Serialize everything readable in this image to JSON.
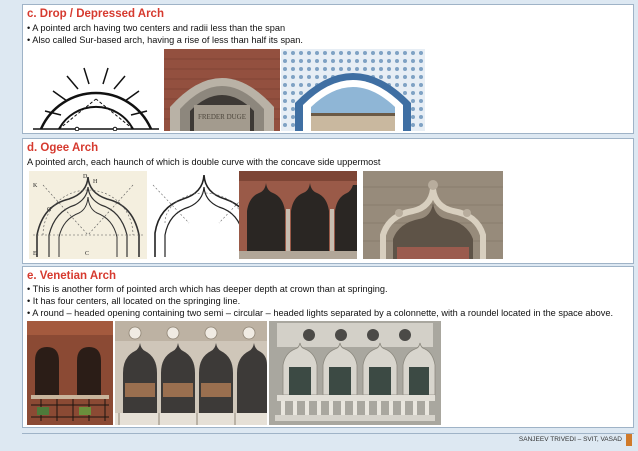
{
  "sections": {
    "drop": {
      "heading": "c. Drop / Depressed Arch",
      "bullets": [
        "• A pointed arch having two centers and radii less than the span",
        "• Also called Sur-based arch, having a rise of less than half its span."
      ],
      "inscription": "FREDER DUGE"
    },
    "ogee": {
      "heading": "d. Ogee Arch",
      "description": "A pointed arch, each haunch of which is double curve with the concave side uppermost",
      "diagram_labels": [
        "D",
        "H",
        "K",
        "G",
        "E",
        "C"
      ]
    },
    "venetian": {
      "heading": "e. Venetian Arch",
      "bullets": [
        "• This is another form of pointed arch which has deeper depth at crown than at springing.",
        "• It has four centers, all located on the springing line.",
        "• A round – headed opening containing two semi – circular – headed lights separated by a colonnette, with a roundel located in the space above."
      ]
    }
  },
  "footer": {
    "credit": "SANJEEV TRIVEDI – SVIT, VASAD"
  },
  "colors": {
    "heading": "#d63a2f",
    "background": "#dde8f2",
    "accent": "#d07a2a"
  }
}
